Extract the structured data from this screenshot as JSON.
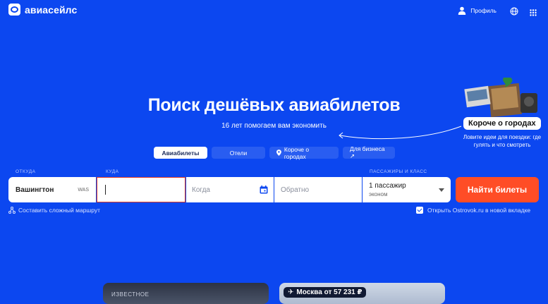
{
  "header": {
    "logo_text": "авиасейлс",
    "profile_label": "Профиль"
  },
  "hero": {
    "title": "Поиск дешёвых авиабилетов",
    "subtitle": "16 лет помогаем вам экономить"
  },
  "tabs": [
    {
      "label": "Авиабилеты",
      "active": true
    },
    {
      "label": "Отели",
      "active": false
    },
    {
      "label": "Короче о городах",
      "active": false
    },
    {
      "label": "Для бизнеса ↗",
      "active": false
    }
  ],
  "promo": {
    "badge": "Короче о городах",
    "text": "Ловите идеи для поездки: где гулять и что смотреть"
  },
  "search": {
    "from_label": "ОТКУДА",
    "to_label": "КУДА",
    "pax_label": "ПАССАЖИРЫ И КЛАСС",
    "from_city": "Вашингтон",
    "from_code": "WAS",
    "to_value": "",
    "when_placeholder": "Когда",
    "back_placeholder": "Обратно",
    "pax_count": "1 пассажир",
    "pax_class": "эконом",
    "submit": "Найти билеты"
  },
  "options": {
    "complex_route": "Составить сложный маршрут",
    "open_ostrovok": "Открыть Ostrovok.ru в новой вкладке",
    "open_ostrovok_checked": true
  },
  "cards": {
    "card1_label": "ИЗВЕСТНОЕ",
    "card2_label": "Москва от 57 231 ₽"
  },
  "colors": {
    "background": "#0c47f0",
    "accent": "#ff4d26",
    "active_field_border": "#e23b26"
  }
}
